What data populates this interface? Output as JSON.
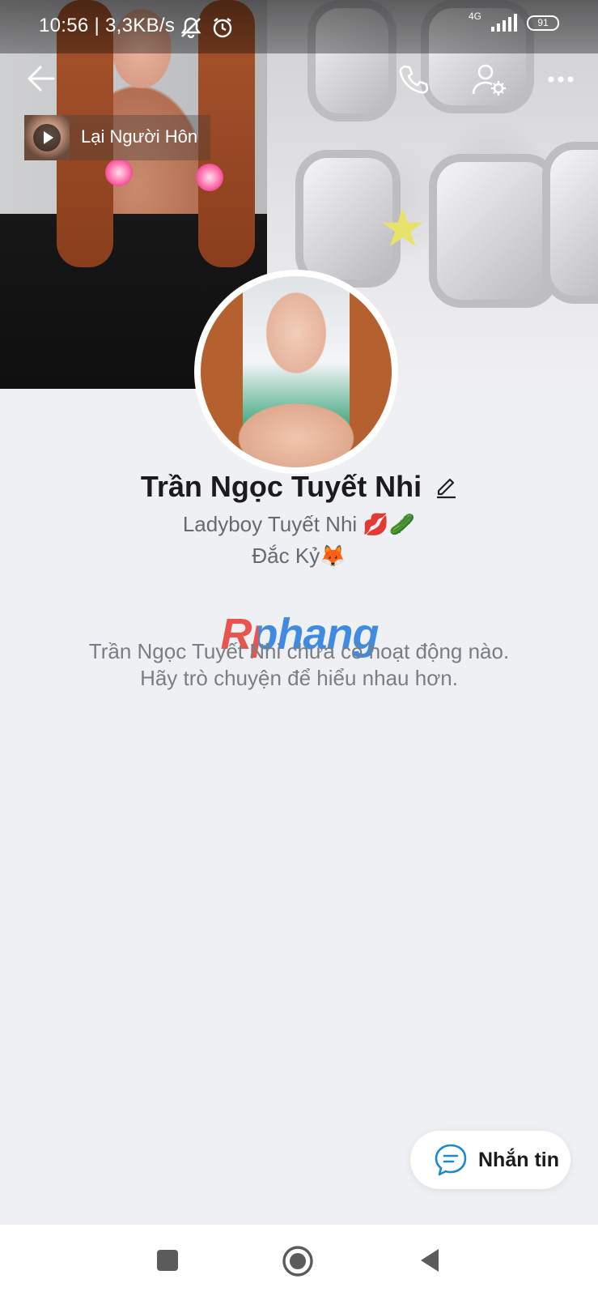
{
  "status_bar": {
    "time_speed": "10:56 | 3,3KB/s",
    "network": "4G",
    "battery": "91"
  },
  "header": {
    "music_title": "Lại Người Hôn"
  },
  "profile": {
    "name": "Trần Ngọc Tuyết Nhi",
    "bio_line1": "Ladyboy Tuyết Nhi 💋🥒",
    "bio_line2": "Đắc Kỷ🦊"
  },
  "watermark": "Rphang",
  "empty_state": {
    "line1": "Trần Ngọc Tuyết Nhi chưa có hoạt động nào.",
    "line2": "Hãy trò chuyện để hiểu nhau hơn."
  },
  "message_button": {
    "label": "Nhắn tin"
  },
  "colors": {
    "accent": "#1a8ad4",
    "background": "#eef0f3"
  },
  "icons": [
    "back-arrow-icon",
    "phone-icon",
    "user-settings-icon",
    "more-icon",
    "play-icon",
    "mute-icon",
    "alarm-icon",
    "chat-icon",
    "square-nav-icon",
    "home-circle-nav-icon",
    "back-triangle-nav-icon"
  ]
}
